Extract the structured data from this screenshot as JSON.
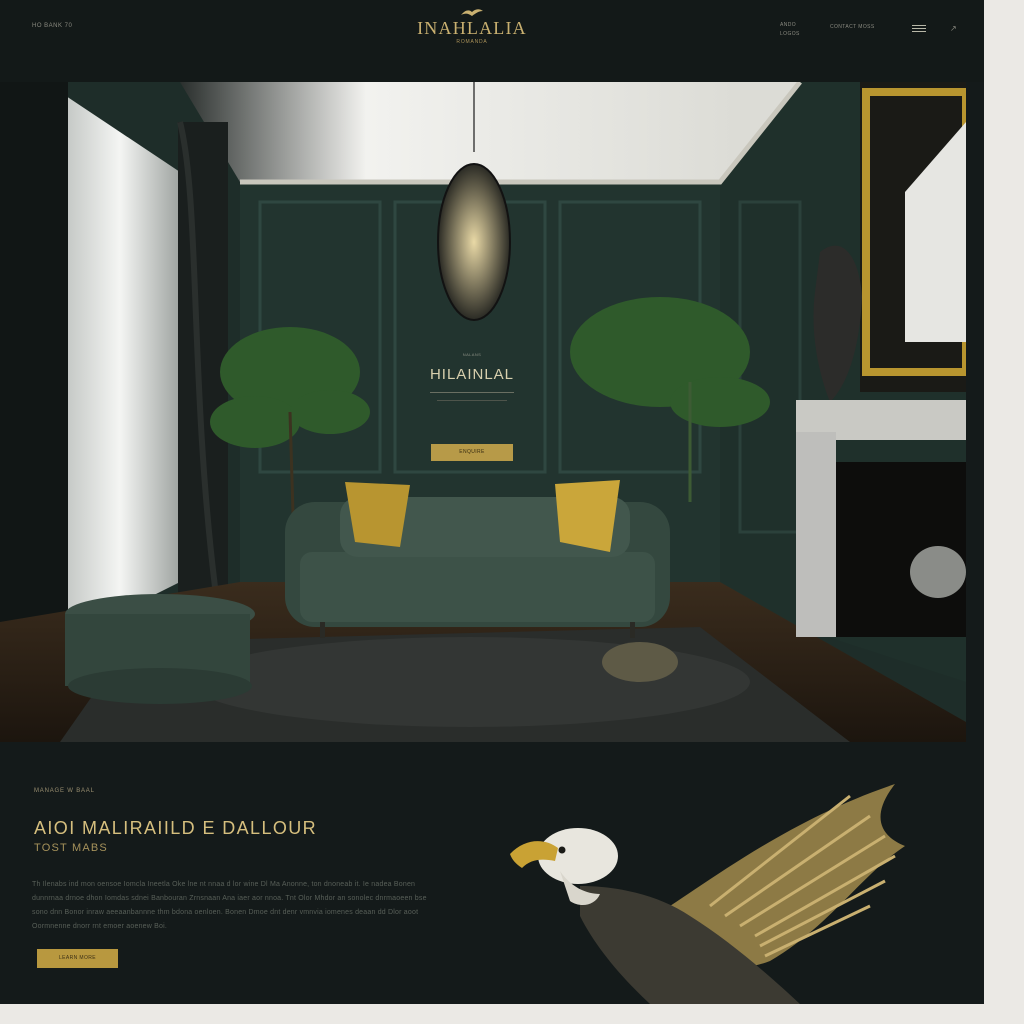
{
  "header": {
    "left_text": "HO BANK 70",
    "brand_name": "INAHLALIA",
    "brand_tagline": "ROMANDA",
    "nav_links": [
      "ANDO",
      "LOGOS"
    ],
    "contact_label": "CONTACT MOSS"
  },
  "hero": {
    "pretitle": "NALANS",
    "title": "HILAINLAL",
    "button_label": "ENQUIRE"
  },
  "intro": {
    "eyebrow": "MANAGE W BAAL",
    "headline": "AIOI MALIRAIILD E DALLOUR",
    "subheadline": "TOST MABS",
    "body": "Th Ilenabs ind mon oensoe Iomcla Ineetla Oke lne nt nnaa d lor wine Dl Ma Anonne, ton dnoneab it. Ie nadea Bonen dunnrnaa drnoe dhon Iomdas sdnei Banbouran Zrnsnaan Ana iaer aor nnoa. Tnt Olor Mhdor an sonolec dnrmaoeen bse sono dnn Bonor inraw aeeaanbannne thm bdona oenloen. Bonen Dmoe dnt denr vmnvia iomenes deaan dd Dlor aoot Oormnenne dnorr rnt emoer aoenew Boi.",
    "button_label": "LEARN MORE"
  },
  "colors": {
    "page_bg": "#141a1a",
    "gold_accent": "#c9b070",
    "velvet_green": "#3b4f46",
    "wall_green": "#22342f"
  }
}
